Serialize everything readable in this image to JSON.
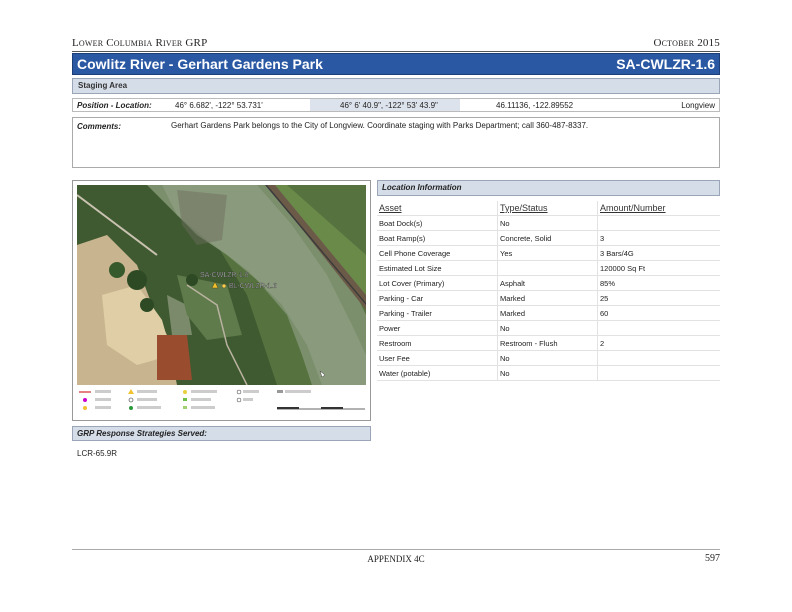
{
  "header": {
    "left": "Lower Columbia River GRP",
    "right": "October 2015"
  },
  "title": {
    "name": "Cowlitz River - Gerhart Gardens Park",
    "code": "SA-CWLZR-1.6"
  },
  "staging_area_label": "Staging Area",
  "position": {
    "label": "Position - Location:",
    "decimal_minutes": "46° 6.682', -122° 53.731'",
    "dms": "46° 6' 40.9\", -122° 53' 43.9\"",
    "decimal_degrees": "46.11136, -122.89552",
    "city": "Longview"
  },
  "comments": {
    "label": "Comments:",
    "text": "Gerhart Gardens Park belongs to the City of Longview. Coordinate staging with Parks Department; call 360-487-8337."
  },
  "map": {
    "label_primary": "SA-CWLZR-1.6",
    "label_secondary": "BL-CWLZR-1.6"
  },
  "location_info": {
    "title": "Location Information",
    "columns": [
      "Asset",
      "Type/Status",
      "Amount/Number"
    ],
    "rows": [
      [
        "Boat Dock(s)",
        "No",
        ""
      ],
      [
        "Boat Ramp(s)",
        "Concrete, Solid",
        "3"
      ],
      [
        "Cell Phone Coverage",
        "Yes",
        "3 Bars/4G"
      ],
      [
        "Estimated Lot Size",
        "",
        "120000 Sq Ft"
      ],
      [
        "Lot Cover (Primary)",
        "Asphalt",
        "85%"
      ],
      [
        "Parking - Car",
        "Marked",
        "25"
      ],
      [
        "Parking - Trailer",
        "Marked",
        "60"
      ],
      [
        "Power",
        "No",
        ""
      ],
      [
        "Restroom",
        "Restroom - Flush",
        "2"
      ],
      [
        "User Fee",
        "No",
        ""
      ],
      [
        "Water (potable)",
        "No",
        ""
      ]
    ]
  },
  "grp": {
    "title": "GRP Response Strategies Served:",
    "value": "LCR-65.9R"
  },
  "footer": {
    "center": "APPENDIX 4C",
    "page": "597"
  }
}
